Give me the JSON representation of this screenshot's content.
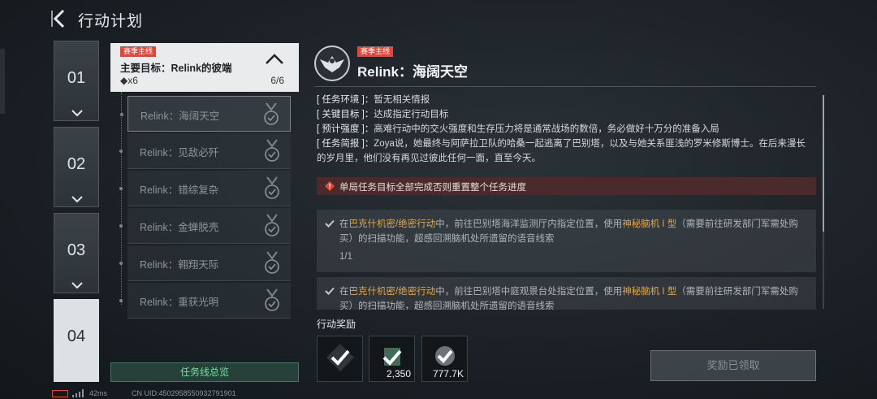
{
  "header": {
    "title": "行动计划"
  },
  "chapters": [
    {
      "label": "01"
    },
    {
      "label": "02"
    },
    {
      "label": "03"
    },
    {
      "label": "04"
    }
  ],
  "main_goal": {
    "badge": "赛季主线",
    "title": "主要目标：Relink的彼端",
    "reward": "◆x6",
    "progress": "6/6"
  },
  "sub_missions": [
    {
      "label": "Relink：海阔天空"
    },
    {
      "label": "Relink：见敌必歼"
    },
    {
      "label": "Relink：错综复杂"
    },
    {
      "label": "Relink：金蝉脱壳"
    },
    {
      "label": "Relink：翱翔天际"
    },
    {
      "label": "Relink：重获光明"
    }
  ],
  "overview_button": "任务线总览",
  "mission": {
    "badge": "赛季主线",
    "name": "Relink：海阔天空",
    "info": [
      {
        "key": "[ 任务环境 ]：",
        "value": "暂无相关情报"
      },
      {
        "key": "[ 关键目标 ]：",
        "value": "达成指定行动目标"
      },
      {
        "key": "[ 预计强度 ]：",
        "value": "高难行动中的交火强度和生存压力将是通常战场的数倍，务必做好十万分的准备入局"
      },
      {
        "key": "[ 任务简报 ]：",
        "value": "Zoya说，她最终与阿萨拉卫队的哈桑一起逃离了巴别塔，以及与她关系匪浅的罗米修斯博士。在后来漫长的岁月里，他们没有再见过彼此任何一面，直至今天。"
      }
    ],
    "warning": "单局任务目标全部完成否则重置整个任务进度"
  },
  "objectives": [
    {
      "p1": "在",
      "h1": "巴克什机密/绝密行动",
      "p2": "中，前往巴别塔海洋监测厅内指定位置，使用",
      "h2": "神秘脑机 I 型",
      "p3": "（需要前往研发部门军需处购买）的扫描功能，超感回溯脑机处所遗留的语音线索",
      "count": "1/1"
    },
    {
      "p1": "在",
      "h1": "巴克什机密/绝密行动",
      "p2": "中，前往巴别塔中庭观景台处指定位置，使用",
      "h2": "神秘脑机 I 型",
      "p3": "（需要前往研发部门军需处购买）的扫描功能，超感回溯脑机处所遗留的语音线索"
    }
  ],
  "rewards": {
    "title": "行动奖励",
    "items": [
      {
        "qty": ""
      },
      {
        "qty": "2,350"
      },
      {
        "qty": "777.7K"
      }
    ]
  },
  "claimed_button": "奖励已领取",
  "status": {
    "ping": "42ms",
    "uid": "CN UID:4502958550932791901"
  },
  "colors": {
    "accent_red": "#e8443a",
    "highlight": "#e0a84a",
    "green": "#6ee3a0"
  }
}
